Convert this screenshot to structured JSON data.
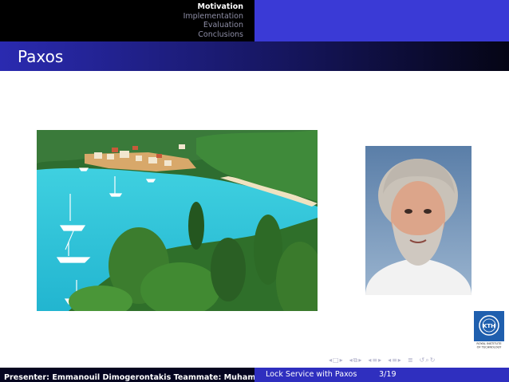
{
  "headline": {
    "sections": [
      {
        "label": "Motivation",
        "active": true
      },
      {
        "label": "Implementation",
        "active": false
      },
      {
        "label": "Evaluation",
        "active": false
      },
      {
        "label": "Conclusions",
        "active": false
      }
    ]
  },
  "frame": {
    "title": "Paxos"
  },
  "images": {
    "paxos_island": "photo-paxos-island",
    "lamport_portrait": "photo-leslie-lamport"
  },
  "logo": {
    "name": "kth-logo",
    "text": "KTH",
    "subtitle": "ROYAL INSTITUTE OF TECHNOLOGY"
  },
  "footline": {
    "presenter": "Presenter: Emmanouil Dimogerontakis Teammate: Muhammet",
    "title": "Lock Service with Paxos",
    "page": "3/19"
  },
  "colors": {
    "headline_left": "#000000",
    "headline_right": "#3a3ad6",
    "footer_left": "#050520",
    "footer_right": "#2f2fbf",
    "accent": "#2a2ab0"
  }
}
